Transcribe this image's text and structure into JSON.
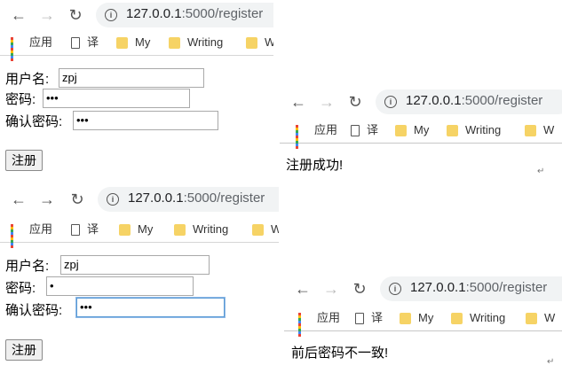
{
  "browser": {
    "url_host": "127.0.0.1",
    "url_path": ":5000/register",
    "bookmarks": [
      "应用",
      "译",
      "My",
      "Writing",
      "W"
    ]
  },
  "form_a": {
    "username_label": "用户名:",
    "username_value": "zpj",
    "password_label": "密码:",
    "password_value": "•••",
    "confirm_label": "确认密码:",
    "confirm_value": "•••",
    "submit_label": "注册"
  },
  "form_b": {
    "username_label": "用户名:",
    "username_value": "zpj",
    "password_label": "密码:",
    "password_value": "•",
    "confirm_label": "确认密码:",
    "confirm_value": "•••",
    "submit_label": "注册"
  },
  "result_success": {
    "message": "注册成功!"
  },
  "result_mismatch": {
    "message": "前后密码不一致!"
  },
  "pilcrow": "↵",
  "colors": {
    "grid_icon": [
      "#ea4335",
      "#fbbc05",
      "#34a853",
      "#4285f4",
      "#ea4335",
      "#fbbc05",
      "#34a853",
      "#4285f4",
      "#ea4335"
    ],
    "folder": "#f6d365",
    "focus": "#5b9bd5"
  }
}
